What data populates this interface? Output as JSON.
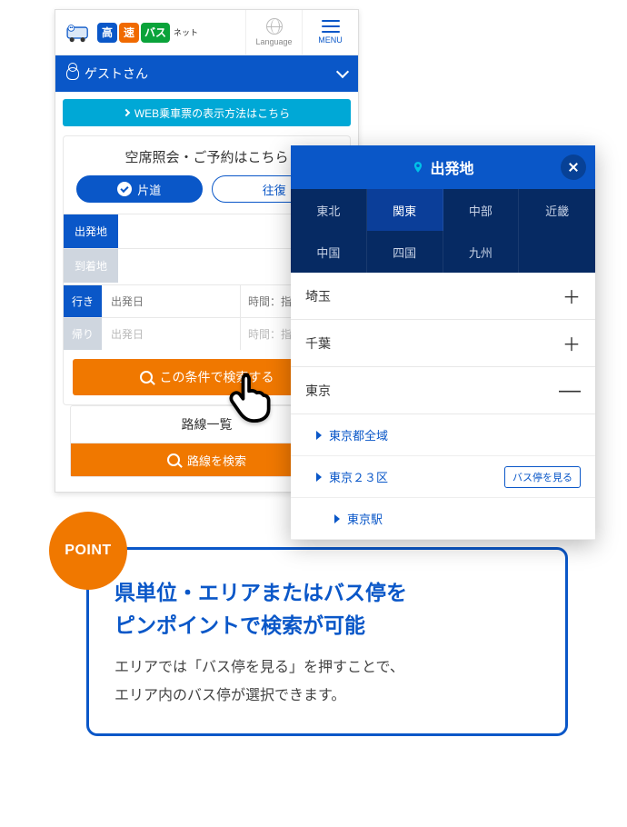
{
  "header": {
    "logo": {
      "ko": "高",
      "so": "速",
      "ba": "バス",
      "net": "ネット"
    },
    "language_label": "Language",
    "menu_label": "MENU"
  },
  "user_bar": {
    "guest": "ゲストさん"
  },
  "teal_banner": "WEB乗車票の表示方法はこちら",
  "search": {
    "title": "空席照会・ご予約はこちら",
    "oneway": "片道",
    "round": "往復",
    "depart_label": "出発地",
    "arrive_label": "到着地",
    "go_tag": "行き",
    "back_tag": "帰り",
    "date_ph": "出発日",
    "time_ph": "時間：指定なし",
    "search_btn": "この条件で検索する"
  },
  "routes": {
    "title": "路線一覧",
    "btn": "路線を検索"
  },
  "overlay": {
    "title": "出発地",
    "regions": [
      "東北",
      "関東",
      "中部",
      "近畿",
      "中国",
      "四国",
      "九州"
    ],
    "active_region_index": 1,
    "prefs": [
      {
        "name": "埼玉",
        "expanded": false
      },
      {
        "name": "千葉",
        "expanded": false
      },
      {
        "name": "東京",
        "expanded": true
      }
    ],
    "tokyo": {
      "all": "東京都全域",
      "wards": "東京２３区",
      "station": "東京駅",
      "view_stops": "バス停を見る"
    }
  },
  "callout": {
    "badge": "POINT",
    "heading_l1": "県単位・エリアまたはバス停を",
    "heading_l2": "ピンポイントで検索が可能",
    "body_l1": "エリアでは「バス停を見る」を押すことで、",
    "body_l2": "エリア内のバス停が選択できます。"
  }
}
